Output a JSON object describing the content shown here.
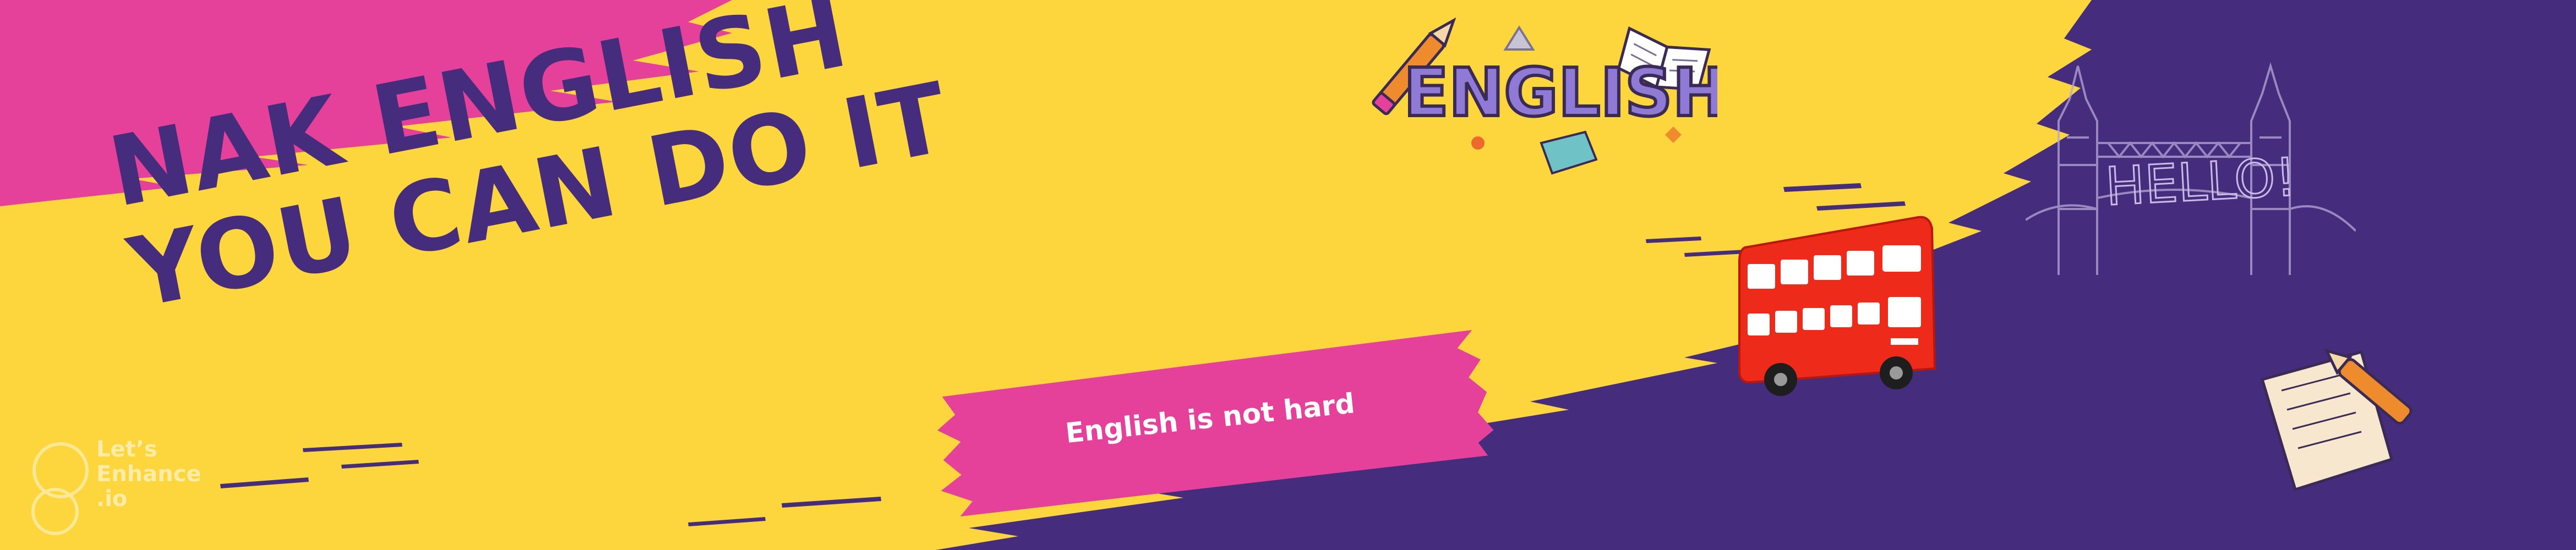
{
  "headline": {
    "line1": "NAK ENGLISH",
    "line2": "YOU CAN DO IT"
  },
  "tagline": "English is not hard",
  "sticker": {
    "word": "ENGLISH"
  },
  "landmark": {
    "greeting": "HELLO!"
  },
  "watermark": {
    "line1": "Let’s",
    "line2": "Enhance",
    "line3": ".io"
  },
  "colors": {
    "yellow": "#FDD63E",
    "pink": "#E5409A",
    "purple": "#452C7C",
    "bus_red": "#EE2A1B",
    "white": "#FFFFFF"
  },
  "icons": [
    "pencil-icon",
    "book-icon",
    "triangle-icon",
    "bus-icon",
    "tower-bridge-icon",
    "paper-and-pen-icon",
    "watermark-logo-icon"
  ]
}
